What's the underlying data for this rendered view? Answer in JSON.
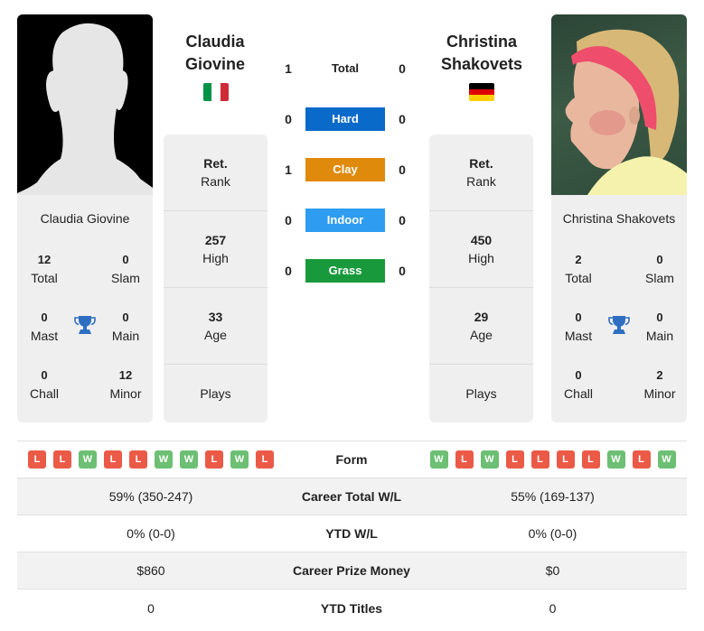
{
  "player1": {
    "name_line1": "Claudia",
    "name_line2": "Giovine",
    "full_name": "Claudia Giovine",
    "country": "Italy",
    "flag_colors": [
      "#009246",
      "#ffffff",
      "#ce2b37"
    ],
    "rank_label_bold": "Ret.",
    "rank_label": "Rank",
    "high_value": "257",
    "high_label": "High",
    "age_value": "33",
    "age_label": "Age",
    "plays_label": "Plays",
    "titles": {
      "total": {
        "value": "12",
        "label": "Total"
      },
      "slam": {
        "value": "0",
        "label": "Slam"
      },
      "mast": {
        "value": "0",
        "label": "Mast"
      },
      "main": {
        "value": "0",
        "label": "Main"
      },
      "chall": {
        "value": "0",
        "label": "Chall"
      },
      "minor": {
        "value": "12",
        "label": "Minor"
      }
    },
    "form": [
      "L",
      "L",
      "W",
      "L",
      "L",
      "W",
      "W",
      "L",
      "W",
      "L"
    ]
  },
  "player2": {
    "name_line1": "Christina",
    "name_line2": "Shakovets",
    "full_name": "Christina Shakovets",
    "country": "Germany",
    "flag_colors": [
      "#000000",
      "#dd0000",
      "#ffce00"
    ],
    "rank_label_bold": "Ret.",
    "rank_label": "Rank",
    "high_value": "450",
    "high_label": "High",
    "age_value": "29",
    "age_label": "Age",
    "plays_label": "Plays",
    "titles": {
      "total": {
        "value": "2",
        "label": "Total"
      },
      "slam": {
        "value": "0",
        "label": "Slam"
      },
      "mast": {
        "value": "0",
        "label": "Mast"
      },
      "main": {
        "value": "0",
        "label": "Main"
      },
      "chall": {
        "value": "0",
        "label": "Chall"
      },
      "minor": {
        "value": "2",
        "label": "Minor"
      }
    },
    "form": [
      "W",
      "L",
      "W",
      "L",
      "L",
      "L",
      "L",
      "W",
      "L",
      "W"
    ]
  },
  "h2h": [
    {
      "surface": "Total",
      "p1": "1",
      "p2": "0",
      "color": ""
    },
    {
      "surface": "Hard",
      "p1": "0",
      "p2": "0",
      "color": "#0a6ac9"
    },
    {
      "surface": "Clay",
      "p1": "1",
      "p2": "0",
      "color": "#e08a0b"
    },
    {
      "surface": "Indoor",
      "p1": "0",
      "p2": "0",
      "color": "#2e9cf0"
    },
    {
      "surface": "Grass",
      "p1": "0",
      "p2": "0",
      "color": "#189a3c"
    }
  ],
  "table": {
    "form_label": "Form",
    "rows": [
      {
        "label": "Career Total W/L",
        "p1": "59% (350-247)",
        "p2": "55% (169-137)"
      },
      {
        "label": "YTD W/L",
        "p1": "0% (0-0)",
        "p2": "0% (0-0)"
      },
      {
        "label": "Career Prize Money",
        "p1": "$860",
        "p2": "$0"
      },
      {
        "label": "YTD Titles",
        "p1": "0",
        "p2": "0"
      }
    ]
  }
}
